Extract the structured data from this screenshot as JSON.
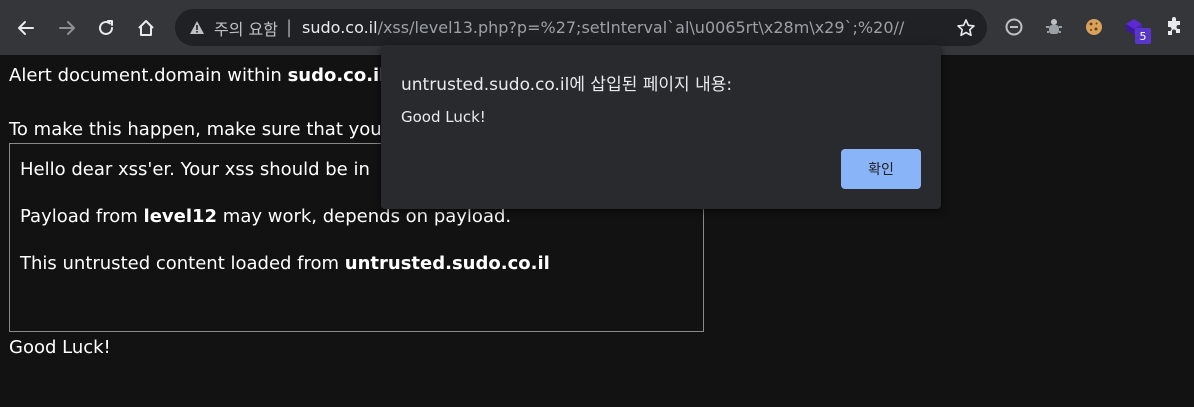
{
  "browser": {
    "security_label": "주의 요함",
    "url_host": "sudo.co.il",
    "url_path": "/xss/level13.php?p=%27;setInterval`al\\u0065rt\\x28m\\x29`;%20//",
    "extension_badge": "5"
  },
  "page": {
    "line1_prefix": "Alert document.domain within ",
    "line1_bold": "sudo.co.il",
    "line2": "To make this happen, make sure that you",
    "frame": {
      "p1": "Hello dear xss'er. Your xss should be in",
      "p2_prefix": "Payload from ",
      "p2_bold": "level12",
      "p2_suffix": " may work, depends on payload.",
      "p3_prefix": "This untrusted content loaded from ",
      "p3_bold": "untrusted.sudo.co.il"
    },
    "footer": "Good Luck!"
  },
  "dialog": {
    "title": "untrusted.sudo.co.il에 삽입된 페이지 내용:",
    "message": "Good Luck!",
    "ok_label": "확인"
  },
  "colors": {
    "toolbar_bg": "#35363a",
    "omnibox_bg": "#202124",
    "page_bg": "#121212",
    "dialog_bg": "#292a2d",
    "dialog_button": "#8ab4f8",
    "extension_badge": "#5a36c8"
  },
  "icons": {
    "back": "arrow-left-icon",
    "forward": "arrow-right-icon",
    "reload": "reload-icon",
    "home": "home-icon",
    "warning": "warning-triangle-icon",
    "bookmark": "star-icon",
    "ext1": "minus-circle-icon",
    "ext2": "bug-icon",
    "ext3": "cookie-icon",
    "ext4": "purple-cube-icon",
    "extensions": "puzzle-icon"
  }
}
